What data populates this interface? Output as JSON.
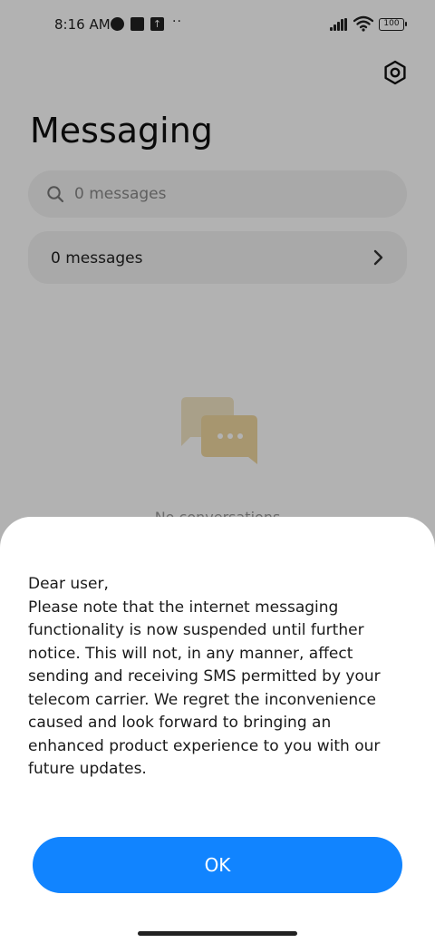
{
  "status_bar": {
    "time": "8:16 AM",
    "dots": "··",
    "battery": "100",
    "icons": [
      "vpn-icon",
      "notification-square-icon",
      "upload-icon",
      "more-dots-icon",
      "signal-icon",
      "wifi-icon",
      "battery-icon"
    ]
  },
  "header": {
    "title": "Messaging",
    "settings_icon": "gear-icon"
  },
  "search": {
    "placeholder": "0 messages"
  },
  "message_row": {
    "label": "0 messages"
  },
  "empty_state": {
    "text": "No conversations"
  },
  "dialog": {
    "greeting": "Dear user,",
    "body": "Please note that the internet messaging functionality is now suspended until further notice. This will not, in any manner, affect sending and receiving SMS permitted by your telecom carrier. We regret the inconvenience caused and look forward to bringing an enhanced product experience to you with our future updates.",
    "button_label": "OK"
  },
  "colors": {
    "accent": "#1184FF",
    "surface": "#F2F2F2",
    "illustration": "#F0DCA8"
  }
}
